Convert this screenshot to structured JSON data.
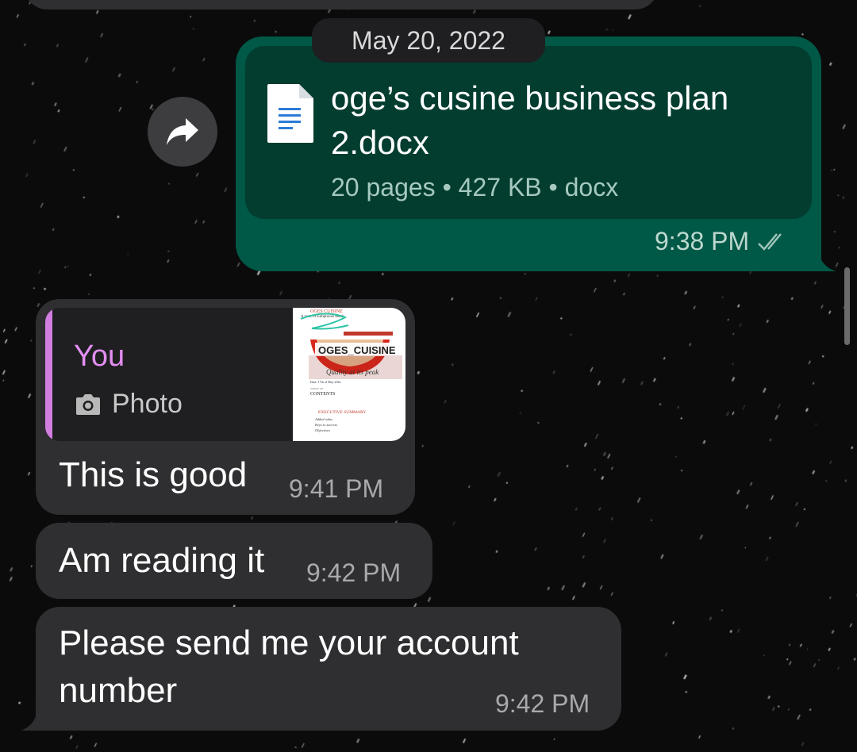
{
  "date_separator": "May 20, 2022",
  "outgoing_document": {
    "file_name": "oge’s cusine business plan 2.docx",
    "meta": "20 pages • 427 KB • docx",
    "time": "9:38 PM",
    "status_icon": "double-check-icon"
  },
  "incoming_reply": {
    "quoted_author": "You",
    "quoted_type": "Photo",
    "quoted_type_icon": "camera-icon",
    "thumbnail": {
      "header": "OGES CUISINE",
      "subheader": "A taste of sumptuous meals",
      "logo_text": "OGES_CUISINE",
      "slogan": "Quality at its peak",
      "date_line": "Date: 17th of May 2022",
      "table_heading": "TABLE OF",
      "contents_heading": "CONTENTS",
      "section_title": "EXECUTIVE SUMMARY",
      "items": [
        "Added value",
        "Keys to success",
        "Objectives"
      ]
    },
    "text": "This is good",
    "time": "9:41 PM"
  },
  "messages": [
    {
      "text": "Am reading it",
      "time": "9:42 PM"
    },
    {
      "line1": "Please send me your account",
      "line2": "number",
      "time": "9:42 PM"
    }
  ],
  "colors": {
    "background": "#0b0b0c",
    "outgoing_bubble": "#005846",
    "incoming_bubble": "#2f2f31",
    "quote_accent": "#d17ee0"
  }
}
